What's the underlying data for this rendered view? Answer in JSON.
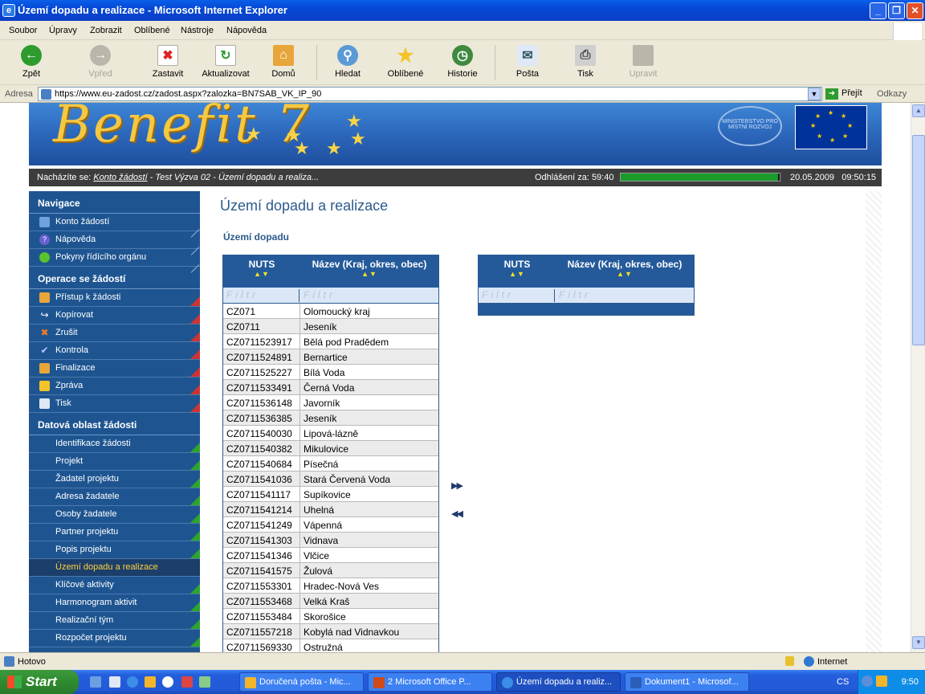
{
  "window": {
    "title": "Území dopadu a realizace - Microsoft Internet Explorer"
  },
  "menu": [
    "Soubor",
    "Úpravy",
    "Zobrazit",
    "Oblíbené",
    "Nástroje",
    "Nápověda"
  ],
  "toolbar": {
    "back": "Zpět",
    "forward": "Vpřed",
    "stop": "Zastavit",
    "refresh": "Aktualizovat",
    "home": "Domů",
    "search": "Hledat",
    "favorites": "Oblíbené",
    "history": "Historie",
    "mail": "Pošta",
    "print": "Tisk",
    "edit": "Upravit"
  },
  "address": {
    "label": "Adresa",
    "url": "https://www.eu-zadost.cz/zadost.aspx?zalozka=BN7SAB_VK_IP_90",
    "go": "Přejít",
    "links": "Odkazy"
  },
  "banner": {
    "logo": "Benefit 7",
    "ministry": "MINISTERSTVO PRO MÍSTNÍ ROZVOJ"
  },
  "status_row": {
    "prefix": "Nacházíte se:",
    "crumb_link": "Konto žádostí",
    "crumb_rest": " - Test Výzva 02 - Území dopadu a realiza...",
    "logout_label": "Odhlášení za:",
    "logout_time": "59:40",
    "progress": 0.99,
    "date": "20.05.2009",
    "time": "09:50:15"
  },
  "sidebar": {
    "nav_title": "Navigace",
    "nav": [
      "Konto žádostí",
      "Nápověda",
      "Pokyny řídícího orgánu"
    ],
    "ops_title": "Operace se žádostí",
    "ops": [
      "Přístup k žádosti",
      "Kopírovat",
      "Zrušit",
      "Kontrola",
      "Finalizace",
      "Zpráva",
      "Tisk"
    ],
    "data_title": "Datová oblast žádosti",
    "data": [
      "Identifikace žádosti",
      "Projekt",
      "Žadatel projektu",
      "Adresa žadatele",
      "Osoby žadatele",
      "Partner projektu",
      "Popis projektu",
      "Území dopadu a realizace",
      "Klíčové aktivity",
      "Harmonogram aktivit",
      "Realizační tým",
      "Rozpočet projektu"
    ]
  },
  "main": {
    "title": "Území dopadu a realizace",
    "subtitle": "Území dopadu",
    "col_nuts": "NUTS",
    "col_name": "Název (Kraj, okres, obec)",
    "filter": "Filtr",
    "rows": [
      [
        "CZ071",
        "Olomoucký kraj"
      ],
      [
        "CZ0711",
        "Jeseník"
      ],
      [
        "CZ0711523917",
        "Bělá pod Pradědem"
      ],
      [
        "CZ0711524891",
        "Bernartice"
      ],
      [
        "CZ0711525227",
        "Bílá Voda"
      ],
      [
        "CZ0711533491",
        "Černá Voda"
      ],
      [
        "CZ0711536148",
        "Javorník"
      ],
      [
        "CZ0711536385",
        "Jeseník"
      ],
      [
        "CZ0711540030",
        "Lipová-lázně"
      ],
      [
        "CZ0711540382",
        "Mikulovice"
      ],
      [
        "CZ0711540684",
        "Písečná"
      ],
      [
        "CZ0711541036",
        "Stará Červená Voda"
      ],
      [
        "CZ0711541117",
        "Supíkovice"
      ],
      [
        "CZ0711541214",
        "Uhelná"
      ],
      [
        "CZ0711541249",
        "Vápenná"
      ],
      [
        "CZ0711541303",
        "Vidnava"
      ],
      [
        "CZ0711541346",
        "Vlčice"
      ],
      [
        "CZ0711541575",
        "Žulová"
      ],
      [
        "CZ0711553301",
        "Hradec-Nová Ves"
      ],
      [
        "CZ0711553468",
        "Velká Kraš"
      ],
      [
        "CZ0711553484",
        "Skorošice"
      ],
      [
        "CZ0711557218",
        "Kobylá nad Vidnavkou"
      ],
      [
        "CZ0711569330",
        "Ostružná"
      ]
    ],
    "add_all": "▶▶",
    "remove_all": "◀◀"
  },
  "statusbar": {
    "text": "Hotovo",
    "zone": "Internet"
  },
  "taskbar": {
    "start": "Start",
    "tasks": [
      "Doručená pošta - Mic...",
      "2 Microsoft Office P...",
      "Území dopadu a realiz...",
      "Dokument1 - Microsof..."
    ],
    "lang": "CS",
    "clock": "9:50"
  }
}
